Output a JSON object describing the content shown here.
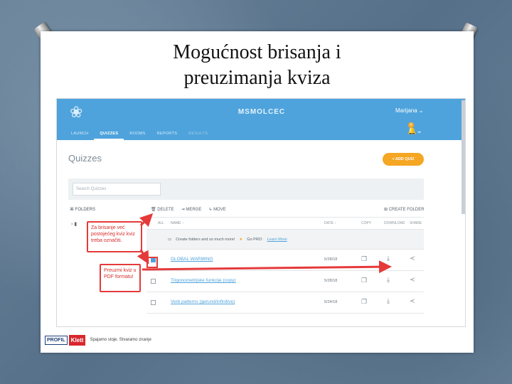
{
  "slide": {
    "title_line1": "Mogućnost brisanja i",
    "title_line2": "preuzimanja kviza"
  },
  "app": {
    "logo_icon": "flower-icon",
    "name": "MSMOLCEC",
    "user": "Marijana ⌄",
    "notification_badge": "0",
    "tabs": [
      {
        "label": "LAUNCH",
        "state": "normal"
      },
      {
        "label": "QUIZZES",
        "state": "active"
      },
      {
        "label": "ROOMS",
        "state": "normal"
      },
      {
        "label": "REPORTS",
        "state": "normal"
      },
      {
        "label": "RESULTS",
        "state": "disabled"
      }
    ]
  },
  "page": {
    "title": "Quizzes",
    "add_quiz": "+ ADD QUIZ",
    "search_placeholder": "Search Quizzes",
    "folders_label": "FOLDERS",
    "toolbar": {
      "delete": "DELETE",
      "merge": "MERGE",
      "move": "MOVE",
      "create_folder": "CREATE FOLDER"
    }
  },
  "table": {
    "headers": {
      "all": "ALL",
      "name": "NAME ↑",
      "date": "DATE ↑",
      "copy": "COPY",
      "download": "DOWNLOAD",
      "share": "SHARE"
    },
    "promo": {
      "text": "Create folders and so much more!",
      "go_pro": "Go PRO:",
      "learn_more": "Learn More"
    },
    "rows": [
      {
        "name": "GLOBAL WARMING",
        "date": "5/28/18",
        "checked": true
      },
      {
        "name": "Trigonometrijske funkcije (copy)",
        "date": "5/28/18",
        "checked": false
      },
      {
        "name": "Verb patterns (gerund/infinitive)",
        "date": "5/24/18",
        "checked": false
      }
    ]
  },
  "callouts": {
    "delete_note": "Za brisanje već postojećeg kviz kviz treba označiti.",
    "download_note": "Preuzmi kviz u PDF formatu!"
  },
  "footer": {
    "brand1": "PROFIL",
    "brand2": "Klett",
    "tagline": "Spajamo stoje. Stvaramo znanje"
  },
  "colors": {
    "topbar": "#4fa3dc",
    "accent": "#f5a623",
    "callout_red": "#e53a3a"
  }
}
